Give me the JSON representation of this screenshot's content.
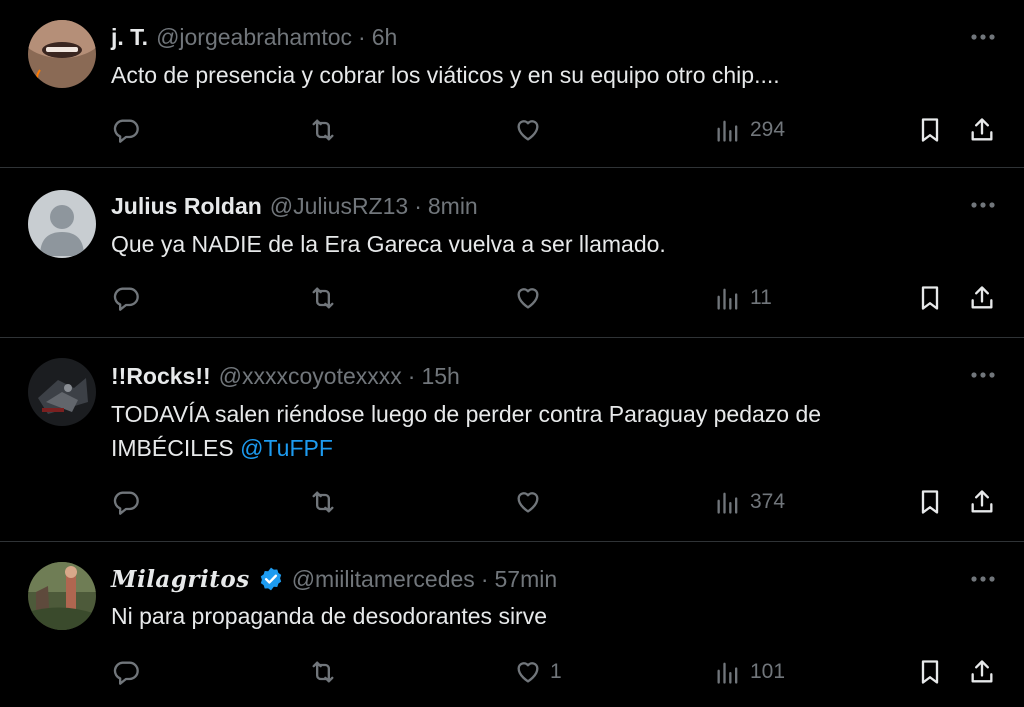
{
  "tweets": [
    {
      "name": "j. T.",
      "handle": "@jorgeabrahamtoc",
      "dot": "·",
      "time": "6h",
      "text": "Acto de presencia y cobrar los viáticos y en su equipo otro chip....",
      "mention": "",
      "likes": "",
      "views": "294",
      "verified": false
    },
    {
      "name": "Julius Roldan",
      "handle": "@JuliusRZ13",
      "dot": "·",
      "time": "8min",
      "text": "Que ya NADIE de la Era Gareca vuelva a ser llamado.",
      "mention": "",
      "likes": "",
      "views": "11",
      "verified": false
    },
    {
      "name": "!!Rocks!!",
      "handle": "@xxxxcoyotexxxx",
      "dot": "·",
      "time": "15h",
      "text": "TODAVÍA salen riéndose luego de perder contra Paraguay pedazo de IMBÉCILES ",
      "mention": "@TuFPF",
      "likes": "",
      "views": "374",
      "verified": false
    },
    {
      "name": "Milagritos",
      "handle": "@miilitamercedes",
      "dot": "·",
      "time": "57min",
      "text": "Ni para propaganda de desodorantes sirve",
      "mention": "",
      "likes": "1",
      "views": "101",
      "verified": true
    }
  ],
  "icons": {
    "reply": "reply-icon",
    "retweet": "retweet-icon",
    "like": "heart-icon",
    "views": "views-icon",
    "bookmark": "bookmark-icon",
    "share": "share-icon",
    "more": "more-icon",
    "verified": "verified-badge-icon"
  },
  "colors": {
    "background": "#000000",
    "text": "#e7e9ea",
    "muted": "#71767b",
    "link": "#1d9bf0",
    "divider": "#2f3336"
  }
}
